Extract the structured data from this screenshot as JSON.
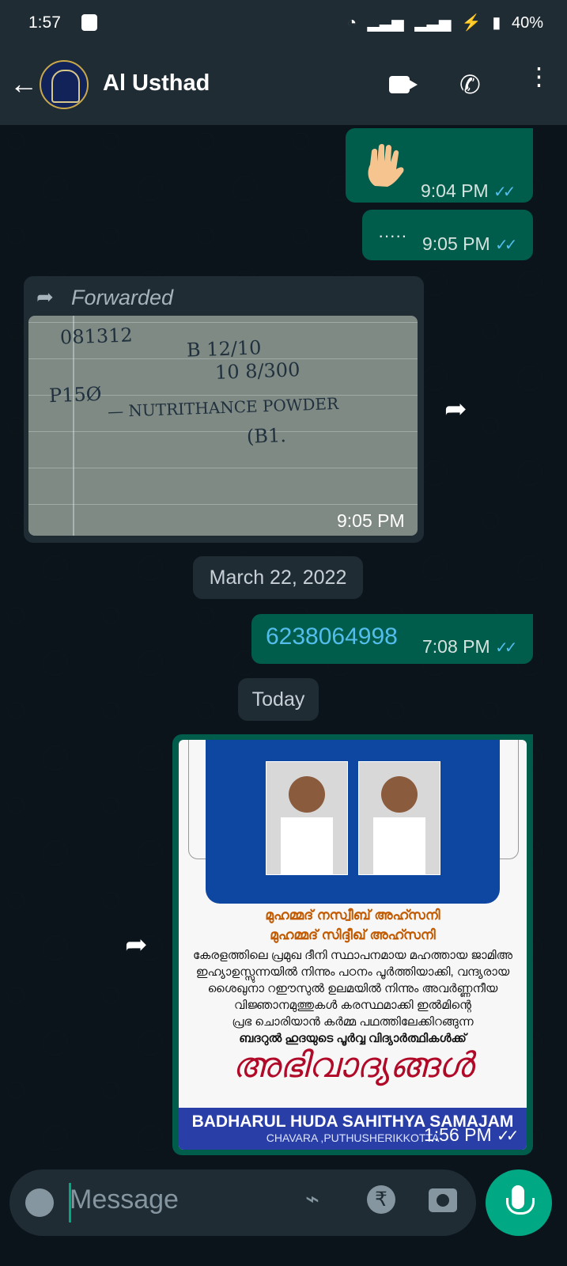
{
  "status_bar": {
    "time": "1:57",
    "battery": "40%"
  },
  "header": {
    "title": "Al Usthad"
  },
  "messages": {
    "m1_time": "9:04 PM",
    "m2_text": "·····",
    "m2_time": "9:05 PM",
    "forwarded_label": "Forwarded",
    "photo_time": "9:05 PM",
    "note_lines": [
      "081312",
      "B 12/10",
      "10 8/300",
      "P15Ø",
      "— NUTRITHANCE POWDER",
      "(B1."
    ],
    "date_separator": "March 22, 2022",
    "phone_number": "6238064998",
    "phone_time": "7:08 PM",
    "today_separator": "Today",
    "poster_time": "1:56 PM"
  },
  "poster": {
    "name_1": "മുഹമ്മദ് നസ്വീബ് അഹ്സനി",
    "name_2": "മുഹമ്മദ് സിദ്ദീഖ് അഹ്സനി",
    "body_lines": [
      "കേരളത്തിലെ പ്രമുഖ ദീനി സ്ഥാപനമായ മഹത്തായ ജാമിഅ",
      "ഇഹ്യാഉസ്സുന്നയിൽ നിന്നും പഠനം പൂർത്തിയാക്കി, വന്ദ്യരായ",
      "ശൈഖുനാ റഈസുൽ ഉലമയിൽ നിന്നും അവർണ്ണനീയ",
      "വിജ്ഞാനമുത്തുകൾ കരസ്ഥമാക്കി ഇൽമിന്റെ",
      "പ്രഭ ചൊരിയാൻ കർമ്മ പഥത്തിലേക്കിറങ്ങുന്ന",
      "ബദറുൽ ഹുദയുടെ പൂർവ്വ വിദ്യാർത്ഥികൾക്ക്"
    ],
    "script_title": "അഭിവാദ്യങ്ങൾ",
    "footer_title": "BADHARUL HUDA SAHITHYA SAMAJAM",
    "footer_sub": "CHAVARA ,PUTHUSHERIKKOTTA"
  },
  "composer": {
    "placeholder": "Message"
  }
}
